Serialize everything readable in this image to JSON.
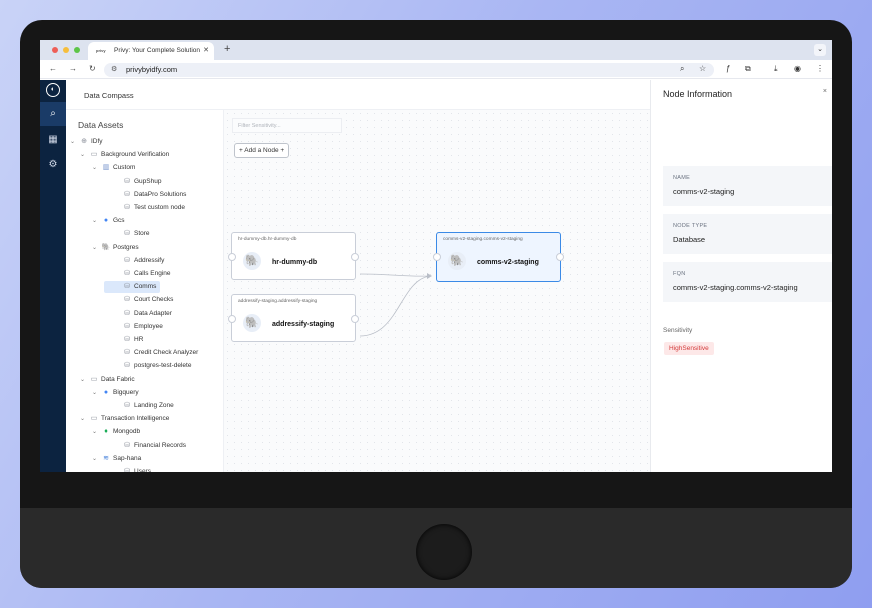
{
  "browser": {
    "tab_title": "Privy: Your Complete Solution",
    "tab_favicon": "privy",
    "new_tab": "+",
    "url": "privybyidfy.com",
    "colors": {
      "close": "#ee5f57",
      "minimize": "#f6be3b",
      "maximize": "#5ec547"
    }
  },
  "app": {
    "breadcrumb": "Data Compass",
    "rail_icons": [
      "compass-icon",
      "search-icon",
      "dashboard-icon",
      "settings-icon"
    ]
  },
  "assets": {
    "title": "Data Assets",
    "tree": [
      {
        "label": "IDfy",
        "icon": "globe-icon",
        "level": 0,
        "expanded": true
      },
      {
        "label": "Background Verification",
        "icon": "folder-icon",
        "level": 1,
        "expanded": true
      },
      {
        "label": "Custom",
        "icon": "custom-icon",
        "level": 2,
        "expanded": true
      },
      {
        "label": "GupShup",
        "icon": "database-icon",
        "level": 3
      },
      {
        "label": "DataPro Solutions",
        "icon": "database-icon",
        "level": 3
      },
      {
        "label": "Test custom node",
        "icon": "database-icon",
        "level": 3
      },
      {
        "label": "Gcs",
        "icon": "gcs-icon",
        "level": 2,
        "expanded": true
      },
      {
        "label": "Store",
        "icon": "database-icon",
        "level": 3
      },
      {
        "label": "Postgres",
        "icon": "postgres-icon",
        "level": 2,
        "expanded": true
      },
      {
        "label": "Addressify",
        "icon": "database-icon",
        "level": 3
      },
      {
        "label": "Calls Engine",
        "icon": "database-icon",
        "level": 3
      },
      {
        "label": "Comms",
        "icon": "database-icon",
        "level": 3,
        "selected": true
      },
      {
        "label": "Court Checks",
        "icon": "database-icon",
        "level": 3
      },
      {
        "label": "Data Adapter",
        "icon": "database-icon",
        "level": 3
      },
      {
        "label": "Employee",
        "icon": "database-icon",
        "level": 3
      },
      {
        "label": "HR",
        "icon": "database-icon",
        "level": 3
      },
      {
        "label": "Credit Check Analyzer",
        "icon": "database-icon",
        "level": 3
      },
      {
        "label": "postgres-test-delete",
        "icon": "database-icon",
        "level": 3
      },
      {
        "label": "Data Fabric",
        "icon": "folder-icon",
        "level": 1,
        "expanded": true
      },
      {
        "label": "Bigquery",
        "icon": "bigquery-icon",
        "level": 2,
        "expanded": true
      },
      {
        "label": "Landing Zone",
        "icon": "database-icon",
        "level": 3
      },
      {
        "label": "Transaction Intelligence",
        "icon": "folder-icon",
        "level": 1,
        "expanded": true
      },
      {
        "label": "Mongodb",
        "icon": "mongodb-icon",
        "level": 2,
        "expanded": true
      },
      {
        "label": "Financial Records",
        "icon": "database-icon",
        "level": 3
      },
      {
        "label": "Sap-hana",
        "icon": "saphana-icon",
        "level": 2,
        "expanded": true
      },
      {
        "label": "Users",
        "icon": "database-icon",
        "level": 3
      }
    ]
  },
  "canvas": {
    "filter_placeholder": "Filter Sensitivity...",
    "add_node": "+ Add a Node +",
    "nodes": [
      {
        "fqn": "hr-dummy-db.hr-dummy-db",
        "name": "hr-dummy-db"
      },
      {
        "fqn": "addressify-staging.addressify-staging",
        "name": "addressify-staging"
      },
      {
        "fqn": "comms-v2-staging.comms-v2-staging",
        "name": "comms-v2-staging",
        "selected": true
      }
    ]
  },
  "panel": {
    "title": "Node Information",
    "close": "×",
    "name_label": "NAME",
    "name_value": "comms-v2-staging",
    "type_label": "NODE TYPE",
    "type_value": "Database",
    "fqn_label": "FQN",
    "fqn_value": "comms-v2-staging.comms-v2-staging",
    "sensitivity_label": "Sensitivity",
    "sensitivity_value": "HighSensitive"
  }
}
